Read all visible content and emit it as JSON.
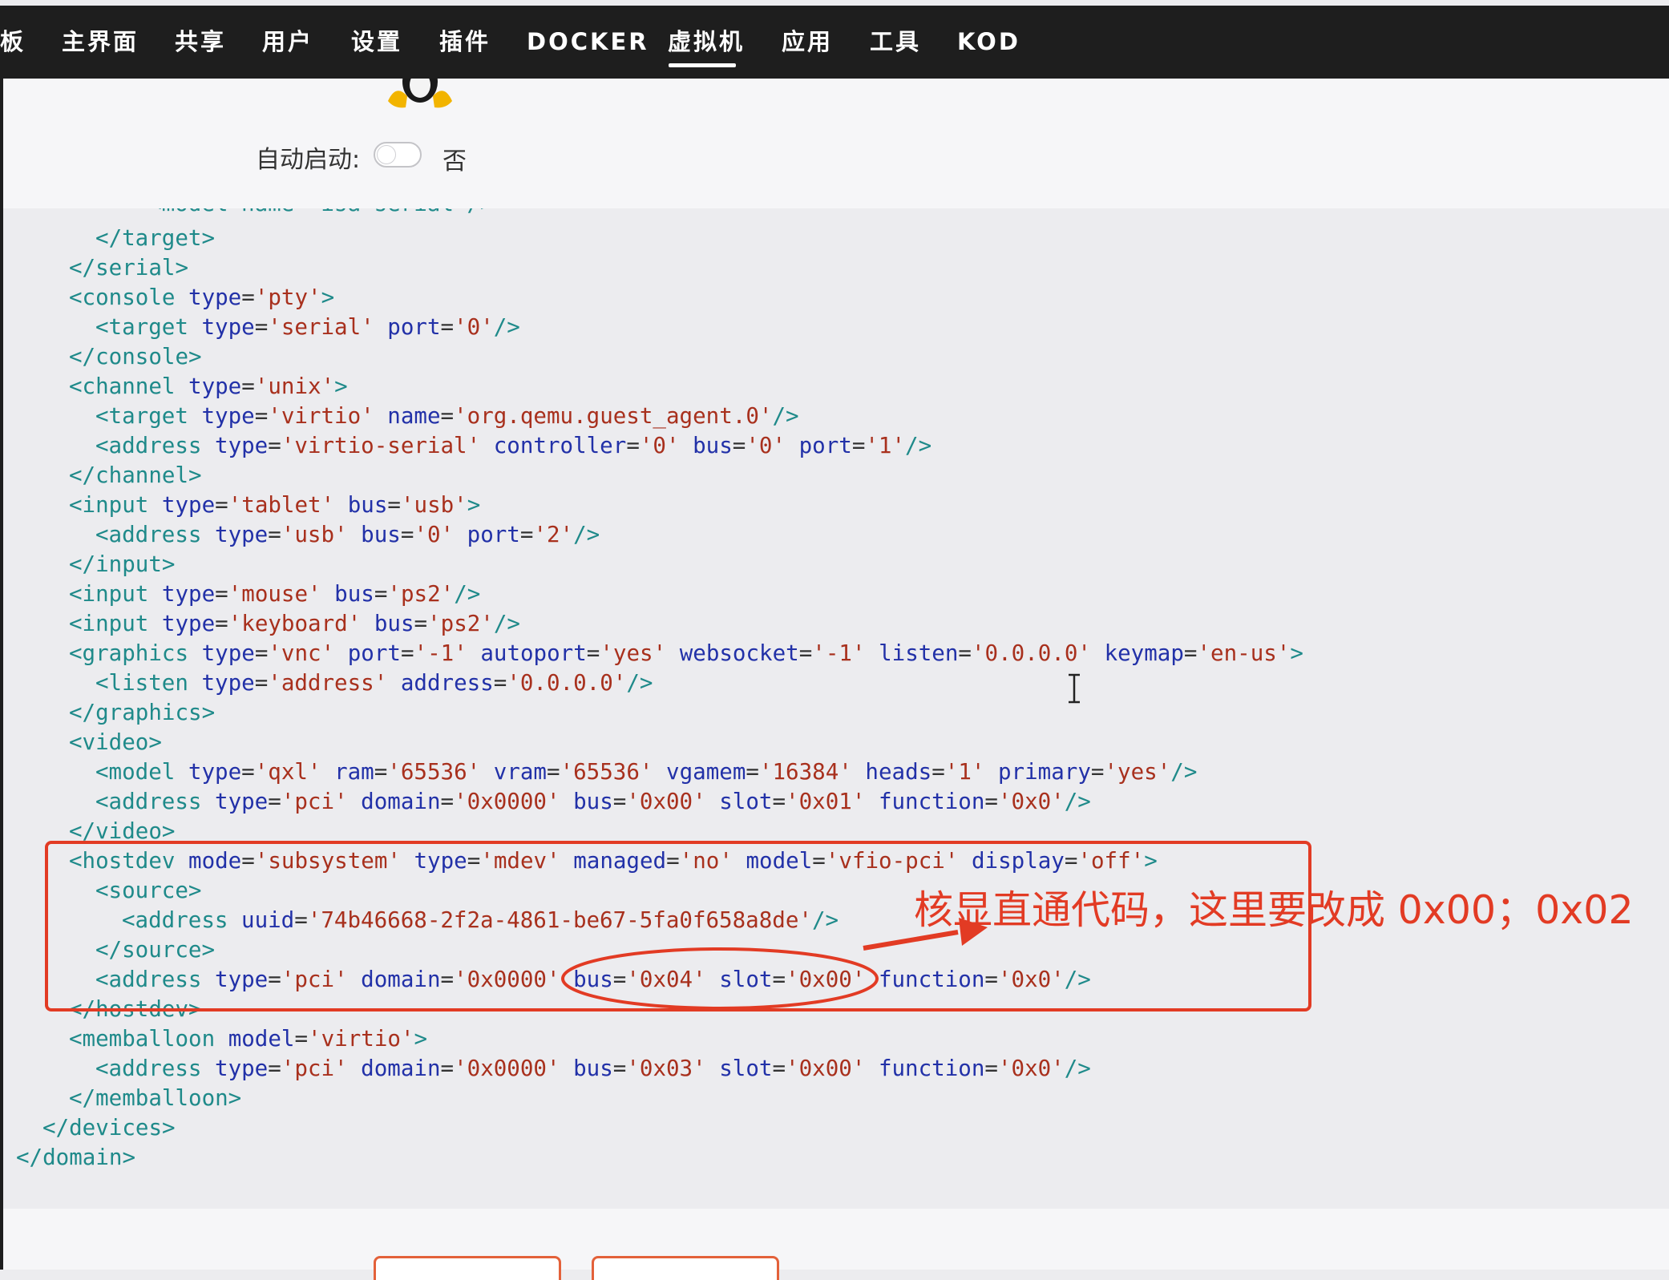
{
  "nav": {
    "items": [
      "板",
      "主界面",
      "共享",
      "用户",
      "设置",
      "插件",
      "DOCKER",
      "虚拟机",
      "应用",
      "工具",
      "KOD"
    ],
    "active": "虚拟机"
  },
  "settings": {
    "autostart_label": "自动启动:",
    "autostart_state": "否"
  },
  "xml": {
    "l01": {
      "a": "  <model name='isa-serial'/>"
    },
    "l02": {
      "t1": "<",
      "t": "/target",
      "t2": ">"
    },
    "l03": {
      "t": "</serial>"
    },
    "l04": {
      "t": "<console",
      "a1": "type",
      "v1": "'pty'",
      "end": ">"
    },
    "l05": {
      "t": "<target",
      "a1": "type",
      "v1": "'serial'",
      "a2": "port",
      "v2": "'0'",
      "end": "/>"
    },
    "l06": {
      "t": "</console>"
    },
    "l07": {
      "t": "<channel",
      "a1": "type",
      "v1": "'unix'",
      "end": ">"
    },
    "l08": {
      "t": "<target",
      "a1": "type",
      "v1": "'virtio'",
      "a2": "name",
      "v2": "'org.qemu.guest_agent.0'",
      "end": "/>"
    },
    "l09": {
      "t": "<address",
      "a1": "type",
      "v1": "'virtio-serial'",
      "a2": "controller",
      "v2": "'0'",
      "a3": "bus",
      "v3": "'0'",
      "a4": "port",
      "v4": "'1'",
      "end": "/>"
    },
    "l10": {
      "t": "</channel>"
    },
    "l11": {
      "t": "<input",
      "a1": "type",
      "v1": "'tablet'",
      "a2": "bus",
      "v2": "'usb'",
      "end": ">"
    },
    "l12": {
      "t": "<address",
      "a1": "type",
      "v1": "'usb'",
      "a2": "bus",
      "v2": "'0'",
      "a3": "port",
      "v3": "'2'",
      "end": "/>"
    },
    "l13": {
      "t": "</input>"
    },
    "l14": {
      "t": "<input",
      "a1": "type",
      "v1": "'mouse'",
      "a2": "bus",
      "v2": "'ps2'",
      "end": "/>"
    },
    "l15": {
      "t": "<input",
      "a1": "type",
      "v1": "'keyboard'",
      "a2": "bus",
      "v2": "'ps2'",
      "end": "/>"
    },
    "l16": {
      "t": "<graphics",
      "a1": "type",
      "v1": "'vnc'",
      "a2": "port",
      "v2": "'-1'",
      "a3": "autoport",
      "v3": "'yes'",
      "a4": "websocket",
      "v4": "'-1'",
      "a5": "listen",
      "v5": "'0.0.0.0'",
      "a6": "keymap",
      "v6": "'en-us'",
      "end": ">"
    },
    "l17": {
      "t": "<listen",
      "a1": "type",
      "v1": "'address'",
      "a2": "address",
      "v2": "'0.0.0.0'",
      "end": "/>"
    },
    "l18": {
      "t": "</graphics>"
    },
    "l19": {
      "t": "<video>"
    },
    "l20": {
      "t": "<model",
      "a1": "type",
      "v1": "'qxl'",
      "a2": "ram",
      "v2": "'65536'",
      "a3": "vram",
      "v3": "'65536'",
      "a4": "vgamem",
      "v4": "'16384'",
      "a5": "heads",
      "v5": "'1'",
      "a6": "primary",
      "v6": "'yes'",
      "end": "/>"
    },
    "l21": {
      "t": "<address",
      "a1": "type",
      "v1": "'pci'",
      "a2": "domain",
      "v2": "'0x0000'",
      "a3": "bus",
      "v3": "'0x00'",
      "a4": "slot",
      "v4": "'0x01'",
      "a5": "function",
      "v5": "'0x0'",
      "end": "/>"
    },
    "l22": {
      "t": "</video>"
    },
    "l23": {
      "t": "<hostdev",
      "a1": "mode",
      "v1": "'subsystem'",
      "a2": "type",
      "v2": "'mdev'",
      "a3": "managed",
      "v3": "'no'",
      "a4": "model",
      "v4": "'vfio-pci'",
      "a5": "display",
      "v5": "'off'",
      "end": ">"
    },
    "l24": {
      "t": "<source>"
    },
    "l25": {
      "t": "<address",
      "a1": "uuid",
      "v1": "'74b46668-2f2a-4861-be67-5fa0f658a8de'",
      "end": "/>"
    },
    "l26": {
      "t": "</source>"
    },
    "l27": {
      "t": "<address",
      "a1": "type",
      "v1": "'pci'",
      "a2": "domain",
      "v2": "'0x0000'",
      "a3": "bus",
      "v3": "'0x04'",
      "a4": "slot",
      "v4": "'0x00'",
      "a5": "function",
      "v5": "'0x0'",
      "end": "/>"
    },
    "l28": {
      "t": "</hostdev>"
    },
    "l29": {
      "t": "<memballoon",
      "a1": "model",
      "v1": "'virtio'",
      "end": ">"
    },
    "l30": {
      "t": "<address",
      "a1": "type",
      "v1": "'pci'",
      "a2": "domain",
      "v2": "'0x0000'",
      "a3": "bus",
      "v3": "'0x03'",
      "a4": "slot",
      "v4": "'0x00'",
      "a5": "function",
      "v5": "'0x0'",
      "end": "/>"
    },
    "l31": {
      "t": "</memballoon>"
    },
    "l32": {
      "t": "</devices>"
    },
    "l33": {
      "t": "</domain>"
    }
  },
  "annotation": {
    "text": "核显直通代码，这里要改成 0x00；0x02",
    "color": "#e23b24"
  },
  "colors": {
    "tag": "#1f8a8a",
    "attr": "#2231a8",
    "value": "#a8301d",
    "nav_bg": "#1e1e1e"
  }
}
